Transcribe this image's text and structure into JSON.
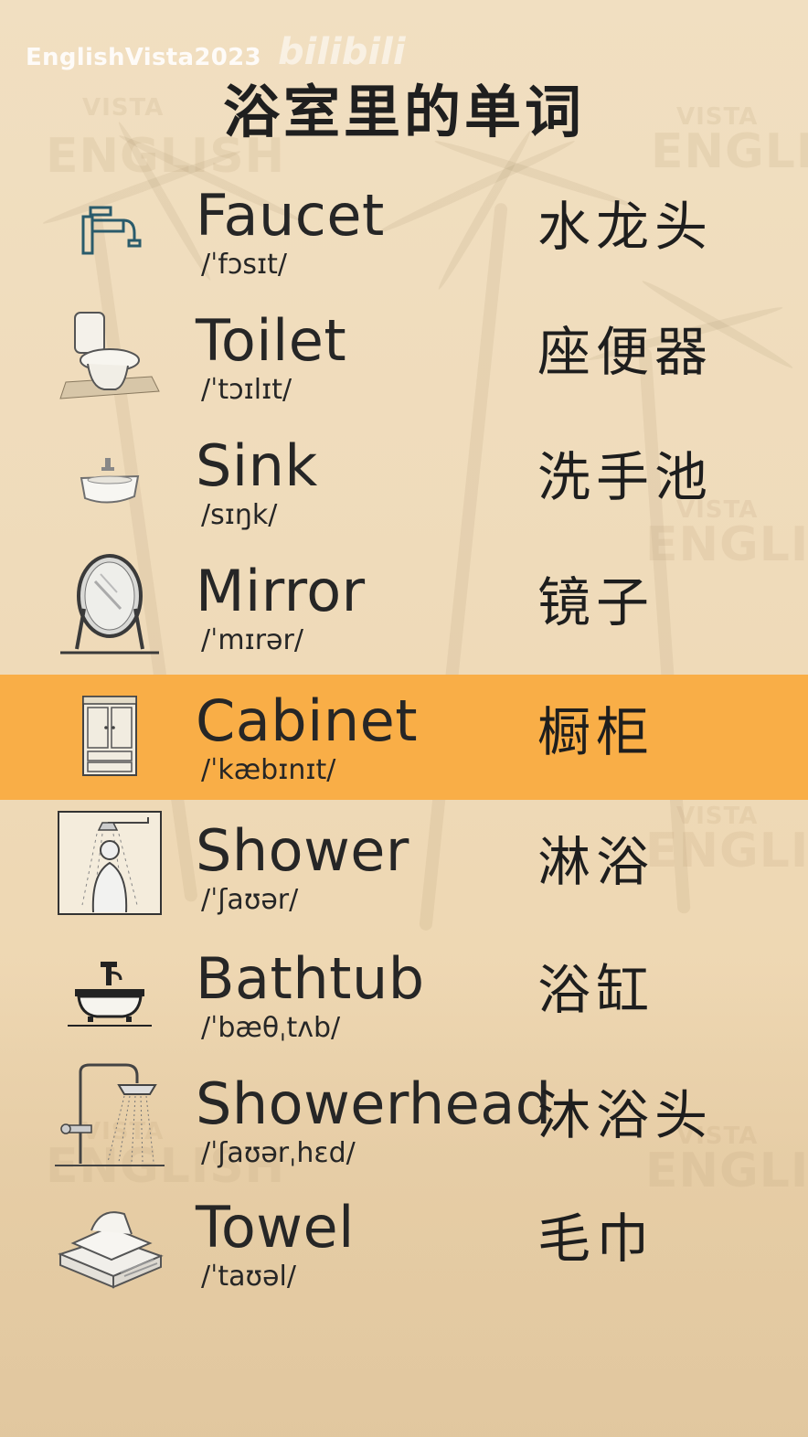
{
  "watermark": {
    "channel": "EnglishVista2023",
    "logo": "bilibili"
  },
  "title": "浴室里的单词",
  "background_marks": [
    "VISTA",
    "ENGLISH"
  ],
  "colors": {
    "background": "#efdbba",
    "highlight": "#f9ae47",
    "text": "#262626"
  },
  "highlighted_index": 4,
  "words": [
    {
      "icon": "faucet-icon",
      "english": "Faucet",
      "phonetic": "/ˈfɔsɪt/",
      "chinese": "水龙头"
    },
    {
      "icon": "toilet-icon",
      "english": "Toilet",
      "phonetic": "/ˈtɔɪlɪt/",
      "chinese": "座便器"
    },
    {
      "icon": "sink-icon",
      "english": "Sink",
      "phonetic": "/sɪŋk/",
      "chinese": "洗手池"
    },
    {
      "icon": "mirror-icon",
      "english": "Mirror",
      "phonetic": "/ˈmɪrər/",
      "chinese": "镜子"
    },
    {
      "icon": "cabinet-icon",
      "english": "Cabinet",
      "phonetic": "/ˈkæbɪnɪt/",
      "chinese": "橱柜"
    },
    {
      "icon": "shower-icon",
      "english": "Shower",
      "phonetic": "/ˈʃaʊər/",
      "chinese": "淋浴"
    },
    {
      "icon": "bathtub-icon",
      "english": "Bathtub",
      "phonetic": "/ˈbæθˌtʌb/",
      "chinese": "浴缸"
    },
    {
      "icon": "showerhead-icon",
      "english": "Showerhead",
      "phonetic": "/ˈʃaʊərˌhɛd/",
      "chinese": "沐浴头"
    },
    {
      "icon": "towel-icon",
      "english": "Towel",
      "phonetic": "/ˈtaʊəl/",
      "chinese": "毛巾"
    }
  ]
}
